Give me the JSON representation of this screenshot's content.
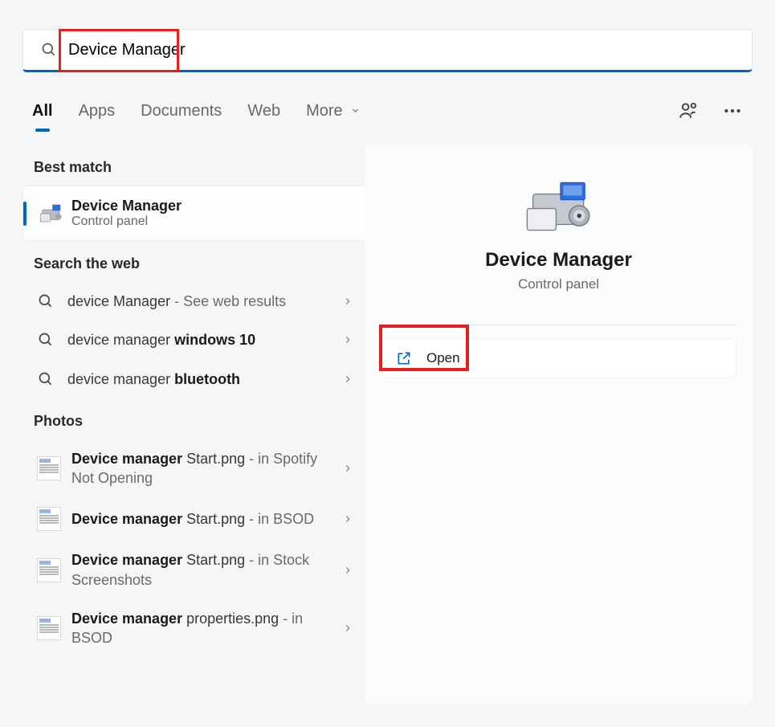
{
  "search": {
    "value": "Device Manager"
  },
  "tabs": {
    "items": [
      "All",
      "Apps",
      "Documents",
      "Web",
      "More"
    ],
    "activeIndex": 0
  },
  "sections": {
    "best_label": "Best match",
    "web_label": "Search the web",
    "photos_label": "Photos"
  },
  "best": {
    "title": "Device Manager",
    "subtitle": "Control panel"
  },
  "web": [
    {
      "plain": "device Manager",
      "bold": "",
      "suffix": " - See web results"
    },
    {
      "plain": "device manager ",
      "bold": "windows 10",
      "suffix": ""
    },
    {
      "plain": "device manager ",
      "bold": "bluetooth",
      "suffix": ""
    }
  ],
  "photos": [
    {
      "bold": "Device manager",
      "rest": " Start.png",
      "suffix": " - in Spotify Not Opening"
    },
    {
      "bold": "Device manager",
      "rest": " Start.png",
      "suffix": " - in BSOD"
    },
    {
      "bold": "Device manager",
      "rest": " Start.png",
      "suffix": " - in Stock Screenshots"
    },
    {
      "bold": "Device manager",
      "rest": " properties.png",
      "suffix": " - in BSOD"
    }
  ],
  "preview": {
    "title": "Device Manager",
    "subtitle": "Control panel",
    "open_label": "Open"
  }
}
